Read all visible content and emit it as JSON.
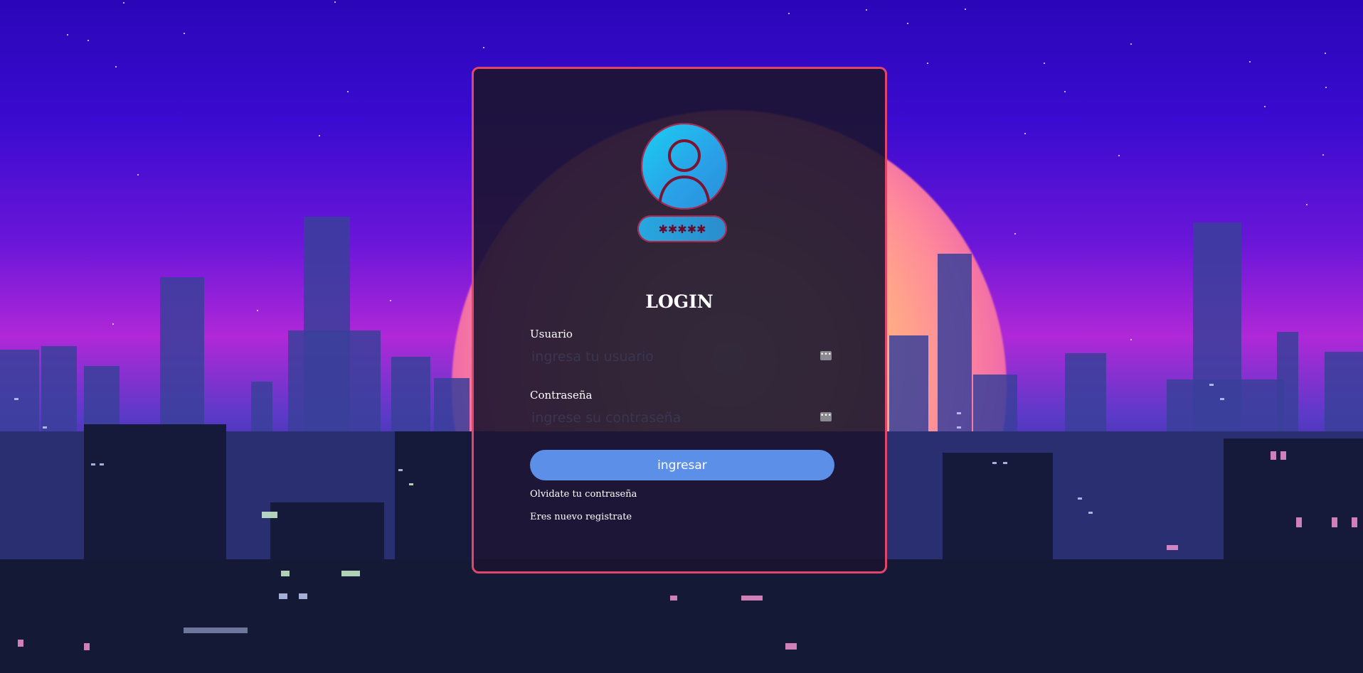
{
  "login": {
    "title": "LOGIN",
    "password_mask": "✱✱✱✱✱",
    "username": {
      "label": "Usuario",
      "placeholder": "ingresa tu usuario",
      "value": ""
    },
    "password": {
      "label": "Contraseña",
      "placeholder": "ingrese su contraseña",
      "value": ""
    },
    "submit_label": "ingresar",
    "forgot_link": "Olvidate tu contraseña",
    "register_link": "Eres nuevo registrate"
  },
  "colors": {
    "card_border": "#e0456a",
    "button": "#5b8fe8",
    "avatar": "#1ad0f0"
  },
  "icons": {
    "avatar": "user-avatar-icon",
    "password": "password-mask-icon",
    "field": "autofill-key-icon"
  }
}
